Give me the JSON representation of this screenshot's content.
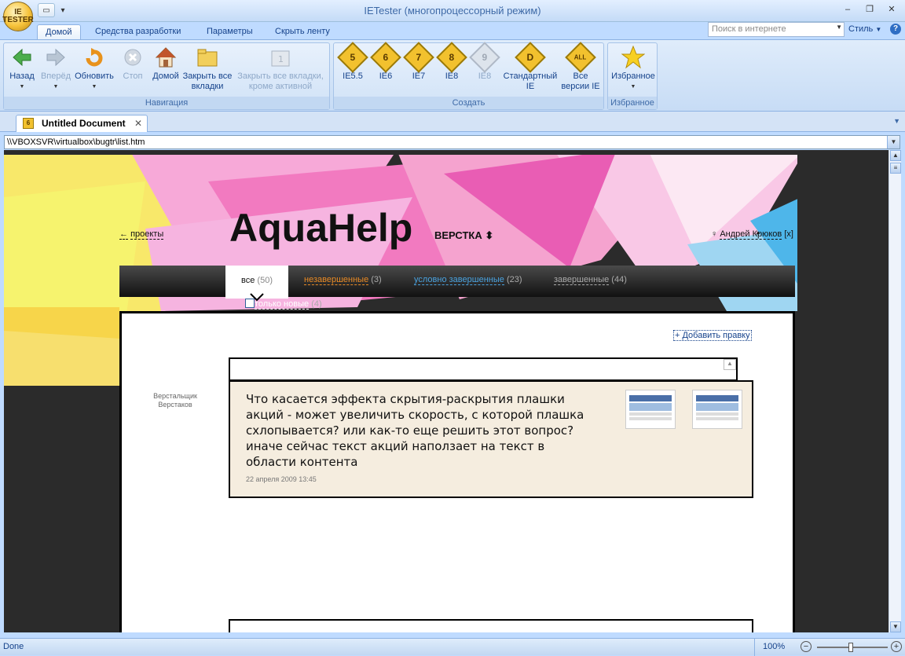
{
  "app": {
    "title": "IETester (многопроцессорный режим)",
    "logo_text": "IE TESTER"
  },
  "ribbon_tabs": [
    "Домой",
    "Средства разработки",
    "Параметры",
    "Скрыть ленту"
  ],
  "search": {
    "placeholder": "Поиск в интернете"
  },
  "style_label": "Стиль",
  "groups": {
    "navigation": {
      "label": "Навигация",
      "buttons": [
        "Назад",
        "Вперёд",
        "Обновить",
        "Стоп",
        "Домой",
        "Закрыть все вкладки",
        "Закрыть все вкладки, кроме активной"
      ]
    },
    "create": {
      "label": "Создать",
      "buttons": [
        {
          "label": "IE5.5",
          "badge": "5"
        },
        {
          "label": "IE6",
          "badge": "6"
        },
        {
          "label": "IE7",
          "badge": "7"
        },
        {
          "label": "IE8",
          "badge": "8"
        },
        {
          "label": "IE8",
          "badge": "9"
        },
        {
          "label": "Стандартный IE",
          "badge": "D"
        },
        {
          "label": "Все версии IE",
          "badge": "ALL"
        }
      ]
    },
    "favorites": {
      "label": "Избранное",
      "button": "Избранное"
    }
  },
  "document_tab": {
    "title": "Untitled Document",
    "badge": "6"
  },
  "address": "\\\\VBOXSVR\\virtualbox\\bugtr\\list.htm",
  "page": {
    "back_link_arrow": "←",
    "back_link": "проекты",
    "logo": "AquaHelp",
    "section": "ВЕРСТКА",
    "section_arrows": "⬍",
    "user_prefix": "♀",
    "user": "Андрей Крюков",
    "user_close": "[x]",
    "filters": {
      "all": {
        "label": "все",
        "count": "(50)"
      },
      "unfinished": {
        "label": "незавершенные",
        "count": "(3)"
      },
      "cond": {
        "label": "условно завершенные",
        "count": "(23)"
      },
      "done": {
        "label": "завершенные",
        "count": "(44)"
      }
    },
    "only_new": {
      "label": "только новые",
      "count": "(4)"
    },
    "add_fix": "+ Добавить правку",
    "author": "Верстальщик Верстаков",
    "comment": "Что касается эффекта скрытия-раскрытия плашки акций - может увеличить скорость, с которой плашка схлопывается? или как-то еще решить этот вопрос? иначе сейчас текст акций наползает на текст в области контента",
    "comment_date": "22 апреля 2009 13:45"
  },
  "status": {
    "text": "Done",
    "zoom": "100%"
  },
  "colors": {
    "ribbon": "#c7dcf5",
    "accent": "#15428b",
    "page_bg": "#2b2b2b",
    "comment_bg": "#f5eddf",
    "unfinished": "#e88a25",
    "conditional": "#4aa3e0",
    "finished": "#aaaaaa"
  }
}
